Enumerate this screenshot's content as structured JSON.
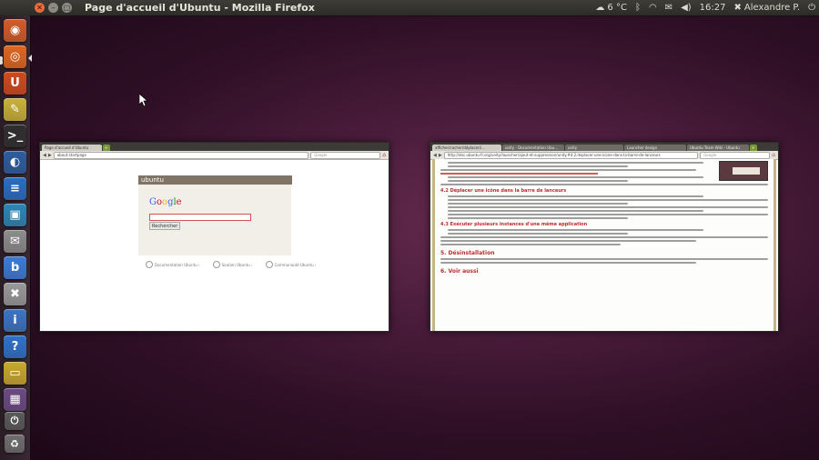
{
  "panel": {
    "window_title": "Page d'accueil d'Ubuntu - Mozilla Firefox",
    "temperature": "6 °C",
    "clock": "16:27",
    "user": "Alexandre P."
  },
  "launcher": {
    "items": [
      {
        "name": "dash-home",
        "glyph": "◉",
        "color": "#d35b2a"
      },
      {
        "name": "firefox",
        "glyph": "◎",
        "color": "#e0671f"
      },
      {
        "name": "ubuntu-software-center",
        "glyph": "U",
        "color": "#d04a1e"
      },
      {
        "name": "text-editor",
        "glyph": "✎",
        "color": "#c9b238"
      },
      {
        "name": "terminal",
        "glyph": ">_",
        "color": "#2f2f2f"
      },
      {
        "name": "system-settings",
        "glyph": "◐",
        "color": "#2d5d9e"
      },
      {
        "name": "writer",
        "glyph": "≡",
        "color": "#2a6dc2"
      },
      {
        "name": "photo-viewer",
        "glyph": "▣",
        "color": "#2c86b5"
      },
      {
        "name": "mail",
        "glyph": "✉",
        "color": "#8d8d8d"
      },
      {
        "name": "blender",
        "glyph": "b",
        "color": "#3d7bd6"
      },
      {
        "name": "tools",
        "glyph": "✖",
        "color": "#9a9a9a"
      },
      {
        "name": "info",
        "glyph": "i",
        "color": "#3b74c4"
      },
      {
        "name": "help",
        "glyph": "?",
        "color": "#2e72c9"
      },
      {
        "name": "display",
        "glyph": "▭",
        "color": "#c9a92c"
      },
      {
        "name": "workspace-switcher",
        "glyph": "▦",
        "color": "#6b4a84"
      },
      {
        "name": "power",
        "glyph": "⏻",
        "color": "#5a5a5a"
      },
      {
        "name": "trash",
        "glyph": "♻",
        "color": "#6e6e6e"
      }
    ]
  },
  "left_window": {
    "tab": "Page d'accueil d'Ubuntu",
    "url": "about:startpage",
    "search_placeholder": "Google",
    "ubuntu_header": "ubuntu",
    "google_logo": "Google",
    "search_button": "Rechercher",
    "links": [
      "Documentation Ubuntu ›",
      "Soutien Ubuntu ›",
      "Communauté Ubuntu ›"
    ]
  },
  "right_window": {
    "tabs": [
      "afficher/cacher/déplacer/i...",
      "unity - Documentation Ubu...",
      "unity",
      "Launcher design",
      "Ubuntu Team Wiki - Ubuntu"
    ],
    "url": "http://doc.ubuntu-fr.org/unity/launcher/ajout-et-suppression/unity.#4.2.deplacer-une-icone-dans-la-barre-de-lanceurs",
    "search_placeholder": "Google",
    "headings": {
      "h42": "4.2 Déplacer une icône dans la barre de lanceurs",
      "h43": "4.3 Exécuter plusieurs instances d'une même application",
      "h5": "5. Désinstallation",
      "h6": "6. Voir aussi"
    }
  }
}
